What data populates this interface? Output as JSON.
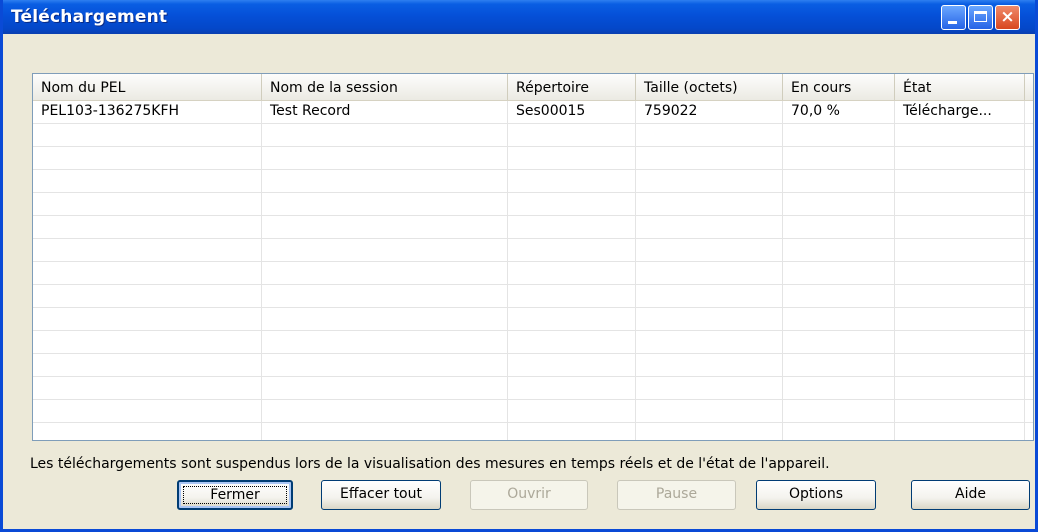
{
  "window": {
    "title": "Téléchargement"
  },
  "titlebar_buttons": {
    "minimize": "minimize-icon",
    "maximize": "maximize-icon",
    "close": "×"
  },
  "list": {
    "columns": [
      "Nom du PEL",
      "Nom de la session",
      "Répertoire",
      "Taille (octets)",
      "En cours",
      "État"
    ],
    "rows": [
      [
        "PEL103-136275KFH",
        "Test Record",
        "Ses00015",
        "759022",
        "70,0 %",
        "Télécharge..."
      ]
    ]
  },
  "note": "Les téléchargements sont suspendus lors de la visualisation des mesures en temps réels et de l'état de l'appareil.",
  "buttons": {
    "fermer": "Fermer",
    "effacer_tout": "Effacer tout",
    "ouvrir": "Ouvrir",
    "pause": "Pause",
    "options": "Options",
    "aide": "Aide"
  },
  "colors": {
    "titlebar": "#0550d8",
    "face": "#ece9d8",
    "close_button": "#d8471f"
  }
}
